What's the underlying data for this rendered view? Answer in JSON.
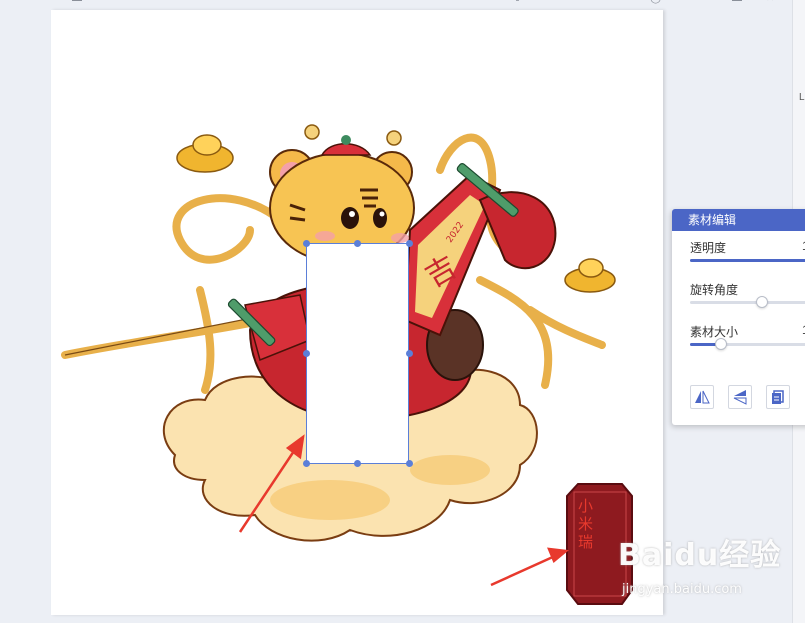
{
  "panel": {
    "title": "素材编辑",
    "sliders": [
      {
        "label": "透明度",
        "value_text": "1",
        "fraction": 1.0
      },
      {
        "label": "旋转角度",
        "value_text": "",
        "fraction": 0.55
      },
      {
        "label": "素材大小",
        "value_text": "1",
        "fraction": 0.24
      }
    ],
    "tools": [
      "flip-horizontal-icon",
      "flip-vertical-icon",
      "copy-layer-icon"
    ]
  },
  "right_strip": {
    "letter": "L"
  },
  "stamp": {
    "text": "小米瑞",
    "color": "#e8392d",
    "bg": "#8e1a1f"
  },
  "watermark": {
    "main": "Baidu经验",
    "sub": "jingyan.baidu.com"
  },
  "colors": {
    "accent": "#4b66c6",
    "selection": "#5b7fd8",
    "arrow": "#e8392d"
  }
}
